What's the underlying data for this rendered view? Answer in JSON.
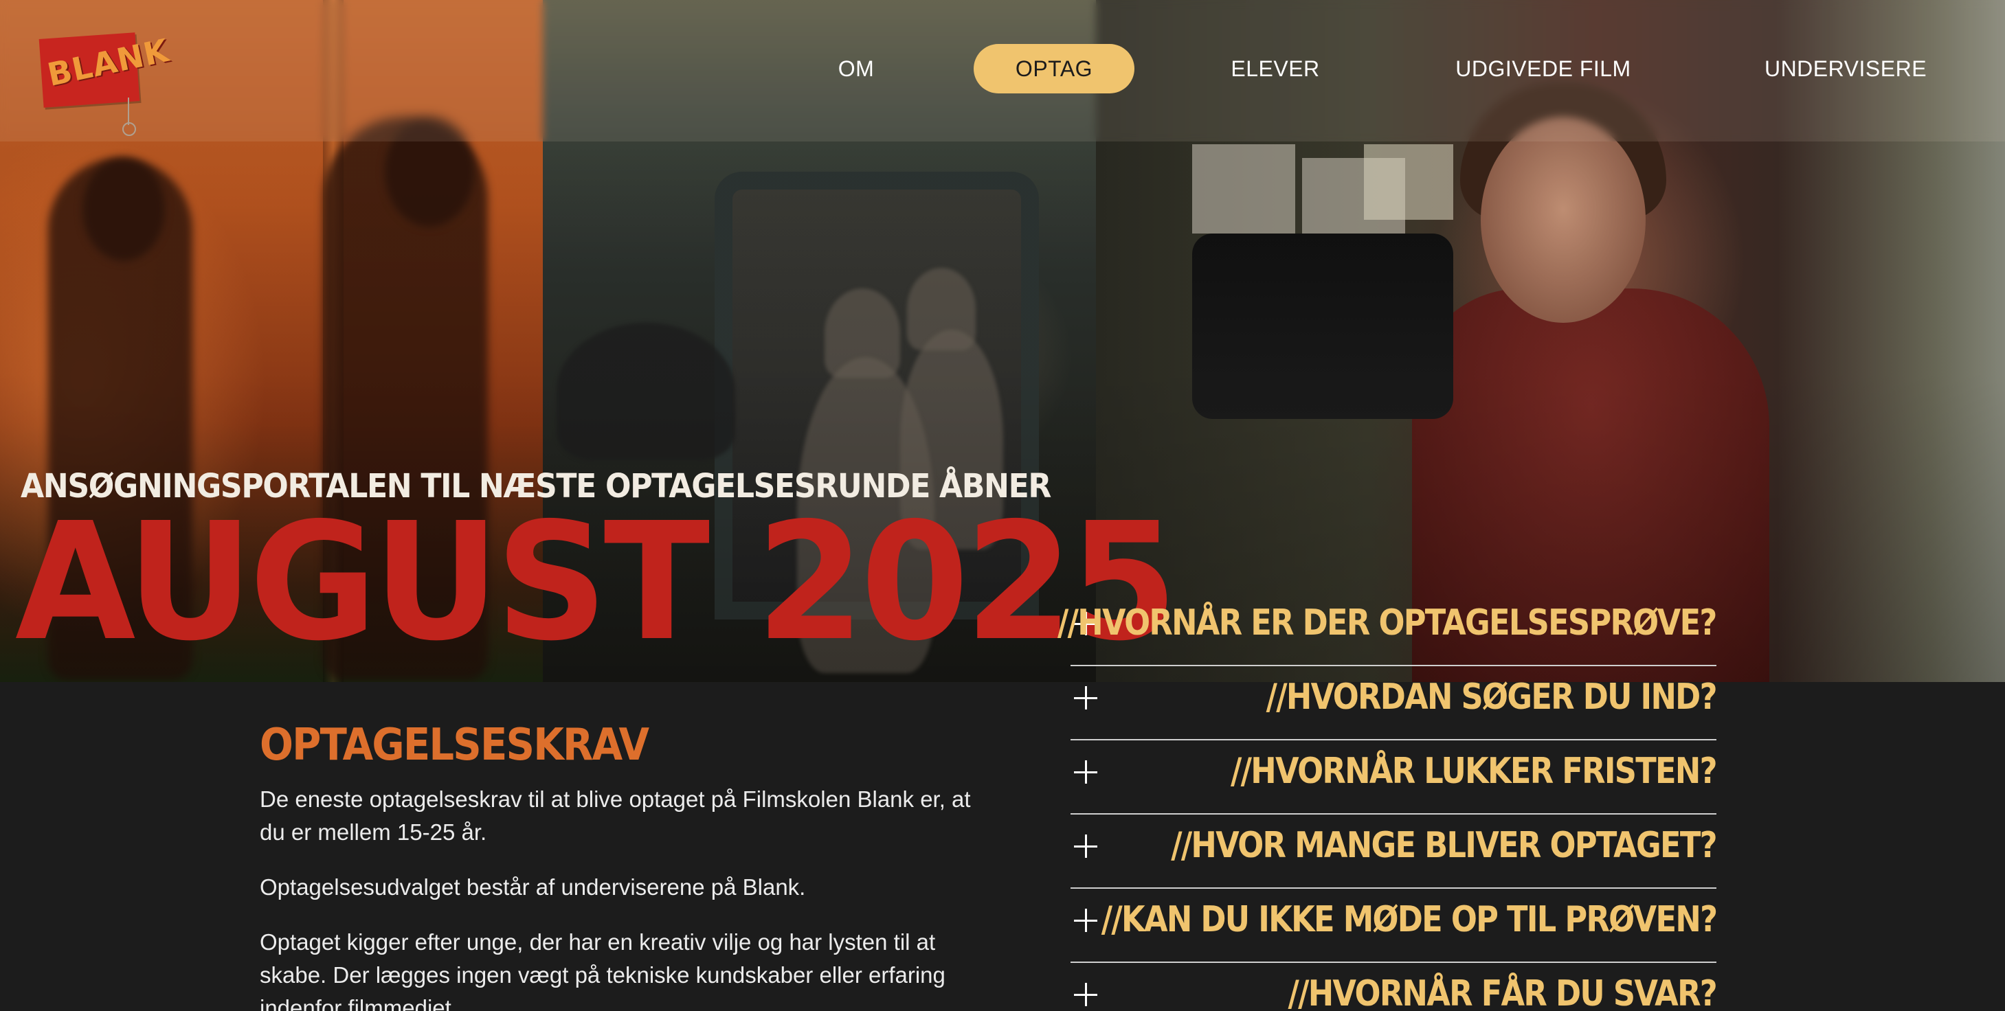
{
  "brand": {
    "logo_text": "BLANK",
    "colors": {
      "accent_yellow": "#f0c46e",
      "accent_red": "#c0231c",
      "accent_orange": "#dd6f2c",
      "background": "#1c1c1c"
    }
  },
  "nav": {
    "items": [
      {
        "label": "OM",
        "active": false
      },
      {
        "label": "OPTAG",
        "active": true
      },
      {
        "label": "ELEVER",
        "active": false
      },
      {
        "label": "UDGIVEDE FILM",
        "active": false
      },
      {
        "label": "UNDERVISERE",
        "active": false
      }
    ]
  },
  "hero": {
    "subheading": "ANSØGNINGSPORTALEN TIL NÆSTE OPTAGELSESRUNDE ÅBNER",
    "date": "AUGUST 2025"
  },
  "requirements": {
    "title": "OPTAGELSESKRAV",
    "paragraphs": [
      "De eneste optagelseskrav til at blive optaget på Filmskolen Blank er, at du er mellem 15-25 år.",
      "Optagelsesudvalget består af underviserene på Blank.",
      "Optaget kigger efter unge, der har en kreativ vilje og har lysten til at skabe. Der lægges ingen vægt på tekniske kundskaber eller erfaring indenfor filmmediet."
    ]
  },
  "faq": {
    "expand_icon": "plus-icon",
    "items": [
      {
        "question": "//HVORNÅR ER DER OPTAGELSESPRØVE?"
      },
      {
        "question": "//HVORDAN SØGER DU IND?"
      },
      {
        "question": "//HVORNÅR LUKKER FRISTEN?"
      },
      {
        "question": "//HVOR MANGE BLIVER OPTAGET?"
      },
      {
        "question": "//KAN DU IKKE MØDE OP TIL PRØVEN?"
      },
      {
        "question": "//HVORNÅR FÅR DU SVAR?"
      }
    ]
  }
}
